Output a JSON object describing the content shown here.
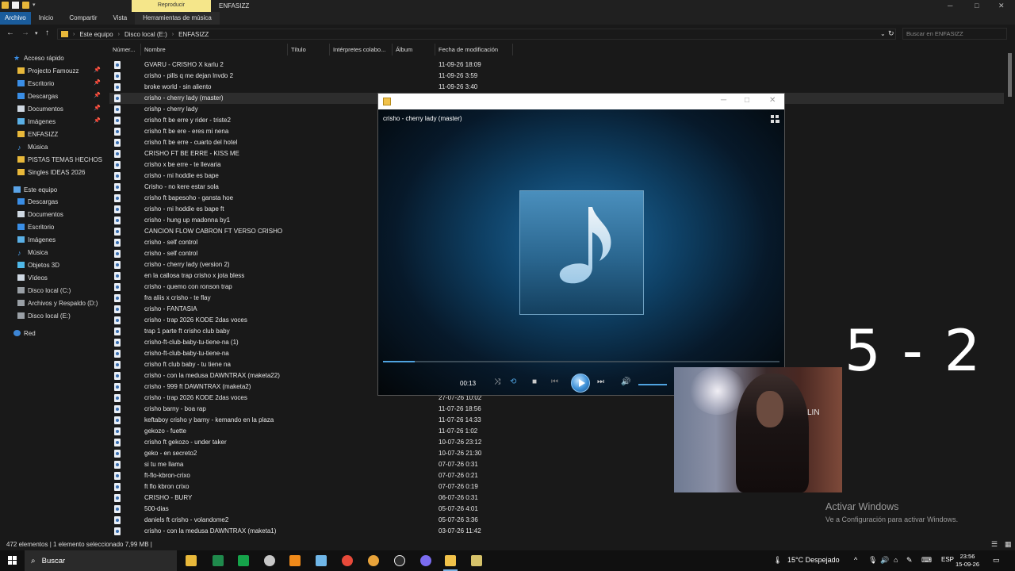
{
  "titlebar": {
    "context_tab": "Reproducir",
    "window_title": "ENFASIZZ",
    "minimize": "─",
    "maximize": "□",
    "close": "✕"
  },
  "ribbon": {
    "tabs": [
      "Archivo",
      "Inicio",
      "Compartir",
      "Vista",
      "Herramientas de música"
    ]
  },
  "address": {
    "crumbs": [
      "Este equipo",
      "Disco local (E:)",
      "ENFASIZZ"
    ],
    "search_placeholder": "Buscar en ENFASIZZ"
  },
  "nav": {
    "quick_access": "Acceso rápido",
    "quick_items": [
      {
        "label": "Projecto Famouzz",
        "icon": "folder-icon",
        "pinned": true
      },
      {
        "label": "Escritorio",
        "icon": "desktop-icon",
        "pinned": true
      },
      {
        "label": "Descargas",
        "icon": "download-icon",
        "pinned": true
      },
      {
        "label": "Documentos",
        "icon": "documents-icon",
        "pinned": true
      },
      {
        "label": "Imágenes",
        "icon": "pictures-icon",
        "pinned": true
      },
      {
        "label": "ENFASIZZ",
        "icon": "folder-icon",
        "pinned": false
      },
      {
        "label": "Música",
        "icon": "music-icon",
        "pinned": false
      },
      {
        "label": "PISTAS TEMAS HECHOS",
        "icon": "folder-icon",
        "pinned": false
      },
      {
        "label": "Singles IDEAS 2026",
        "icon": "folder-icon",
        "pinned": false
      }
    ],
    "this_pc": "Este equipo",
    "pc_items": [
      {
        "label": "Descargas",
        "icon": "download-icon"
      },
      {
        "label": "Documentos",
        "icon": "documents-icon"
      },
      {
        "label": "Escritorio",
        "icon": "desktop-icon"
      },
      {
        "label": "Imágenes",
        "icon": "pictures-icon"
      },
      {
        "label": "Música",
        "icon": "music-icon"
      },
      {
        "label": "Objetos 3D",
        "icon": "3d-objects-icon"
      },
      {
        "label": "Vídeos",
        "icon": "videos-icon"
      },
      {
        "label": "Disco local (C:)",
        "icon": "drive-icon"
      },
      {
        "label": "Archivos y Respaldo (D:)",
        "icon": "drive-icon"
      },
      {
        "label": "Disco local (E:)",
        "icon": "drive-icon"
      }
    ],
    "network": "Red"
  },
  "columns": [
    "Númer...",
    "Nombre",
    "Título",
    "Intérpretes colabo...",
    "Álbum",
    "Fecha de modificación"
  ],
  "files": [
    {
      "name": "GVARU - CRISHO X karlu 2",
      "date": "11-09-26 18:09"
    },
    {
      "name": "crisho - pills q me dejan lnvdo 2",
      "date": "11-09-26 3:59"
    },
    {
      "name": "broke world - sin aliento",
      "date": "11-09-26 3:40"
    },
    {
      "name": "crisho - cherry lady (master)",
      "date": ""
    },
    {
      "name": "crishp - cherry lady",
      "date": ""
    },
    {
      "name": "crisho ft be erre y rider - triste2",
      "date": ""
    },
    {
      "name": "crisho ft be ere - eres mi nena",
      "date": ""
    },
    {
      "name": "crisho ft be erre - cuarto del hotel",
      "date": ""
    },
    {
      "name": "CRISHO FT BE ERRE - KISS ME",
      "date": ""
    },
    {
      "name": "crisho x be erre - te llevaria",
      "date": ""
    },
    {
      "name": "crisho - mi hoddie es bape",
      "date": ""
    },
    {
      "name": "Crisho - no kere estar sola",
      "date": ""
    },
    {
      "name": "crisho ft bapesoho - gansta hoe",
      "date": ""
    },
    {
      "name": "crisho - mi hoddie es bape ft",
      "date": ""
    },
    {
      "name": "crisho - hung up madonna by1",
      "date": ""
    },
    {
      "name": "CANCION FLOW CABRON FT VERSO CRISHO",
      "date": ""
    },
    {
      "name": "crisho - self control",
      "date": ""
    },
    {
      "name": "crisho - self control",
      "date": ""
    },
    {
      "name": "crisho - cherry lady (version 2)",
      "date": ""
    },
    {
      "name": "en la callosa trap crisho x jota bless",
      "date": ""
    },
    {
      "name": "crisho - quemo con ronson trap",
      "date": ""
    },
    {
      "name": "fra aliis x crisho - te flay",
      "date": ""
    },
    {
      "name": "crisho - FANTASIA",
      "date": ""
    },
    {
      "name": "crisho - trap 2026 KODE 2das voces",
      "date": ""
    },
    {
      "name": "trap 1 parte ft crisho club baby",
      "date": ""
    },
    {
      "name": "crisho-ft-club-baby-tu-tiene-na (1)",
      "date": ""
    },
    {
      "name": "crisho-ft-club-baby-tu-tiene-na",
      "date": ""
    },
    {
      "name": "crisho ft club baby - tu tiene na",
      "date": ""
    },
    {
      "name": "crisho - con la medusa DAWNTRAX (maketa22)",
      "date": ""
    },
    {
      "name": "crisho - 999 ft  DAWNTRAX (maketa2)",
      "date": ""
    },
    {
      "name": "crisho - trap 2026 KODE 2das voces",
      "date": "27-07-26 10:02"
    },
    {
      "name": "crisho barny - boa rap",
      "date": "11-07-26 18:56"
    },
    {
      "name": "keftaboy crisho y barny - kemando en la plaza",
      "date": "11-07-26 14:33"
    },
    {
      "name": "gekozo - fuette",
      "date": "11-07-26 1:02"
    },
    {
      "name": "crisho  ft gekozo - under taker",
      "date": "10-07-26 23:12"
    },
    {
      "name": "geko - en secreto2",
      "date": "10-07-26 21:30"
    },
    {
      "name": "si tu me llama",
      "date": "07-07-26 0:31"
    },
    {
      "name": "ft-flo-kbron-crixo",
      "date": "07-07-26 0:21"
    },
    {
      "name": "ft flo kbron crixo",
      "date": "07-07-26 0:19"
    },
    {
      "name": "CRISHO - BURY",
      "date": "06-07-26 0:31"
    },
    {
      "name": "500-dias",
      "date": "05-07-26 4:01"
    },
    {
      "name": "daniels ft crisho - volandome2",
      "date": "05-07-26 3:36"
    },
    {
      "name": "crisho - con la medusa DAWNTRAX (maketa1)",
      "date": "03-07-26 11:42"
    }
  ],
  "selected_index": 3,
  "player": {
    "song": "crisho - cherry lady (master)",
    "elapsed": "00:13",
    "progress": 0.08,
    "volume": 0.6
  },
  "overlay": {
    "score": "5 - 2",
    "webcam_sign": "LIN"
  },
  "watermark": {
    "title": "Activar Windows",
    "subtitle": "Ve a Configuración para activar Windows."
  },
  "status": "472 elementos   |   1 elemento seleccionado  7,99 MB   |",
  "taskbar": {
    "search": "Buscar",
    "weather": "15°C  Despejado",
    "lang": "ESP",
    "time": "23:56",
    "date": "15-09-26"
  }
}
